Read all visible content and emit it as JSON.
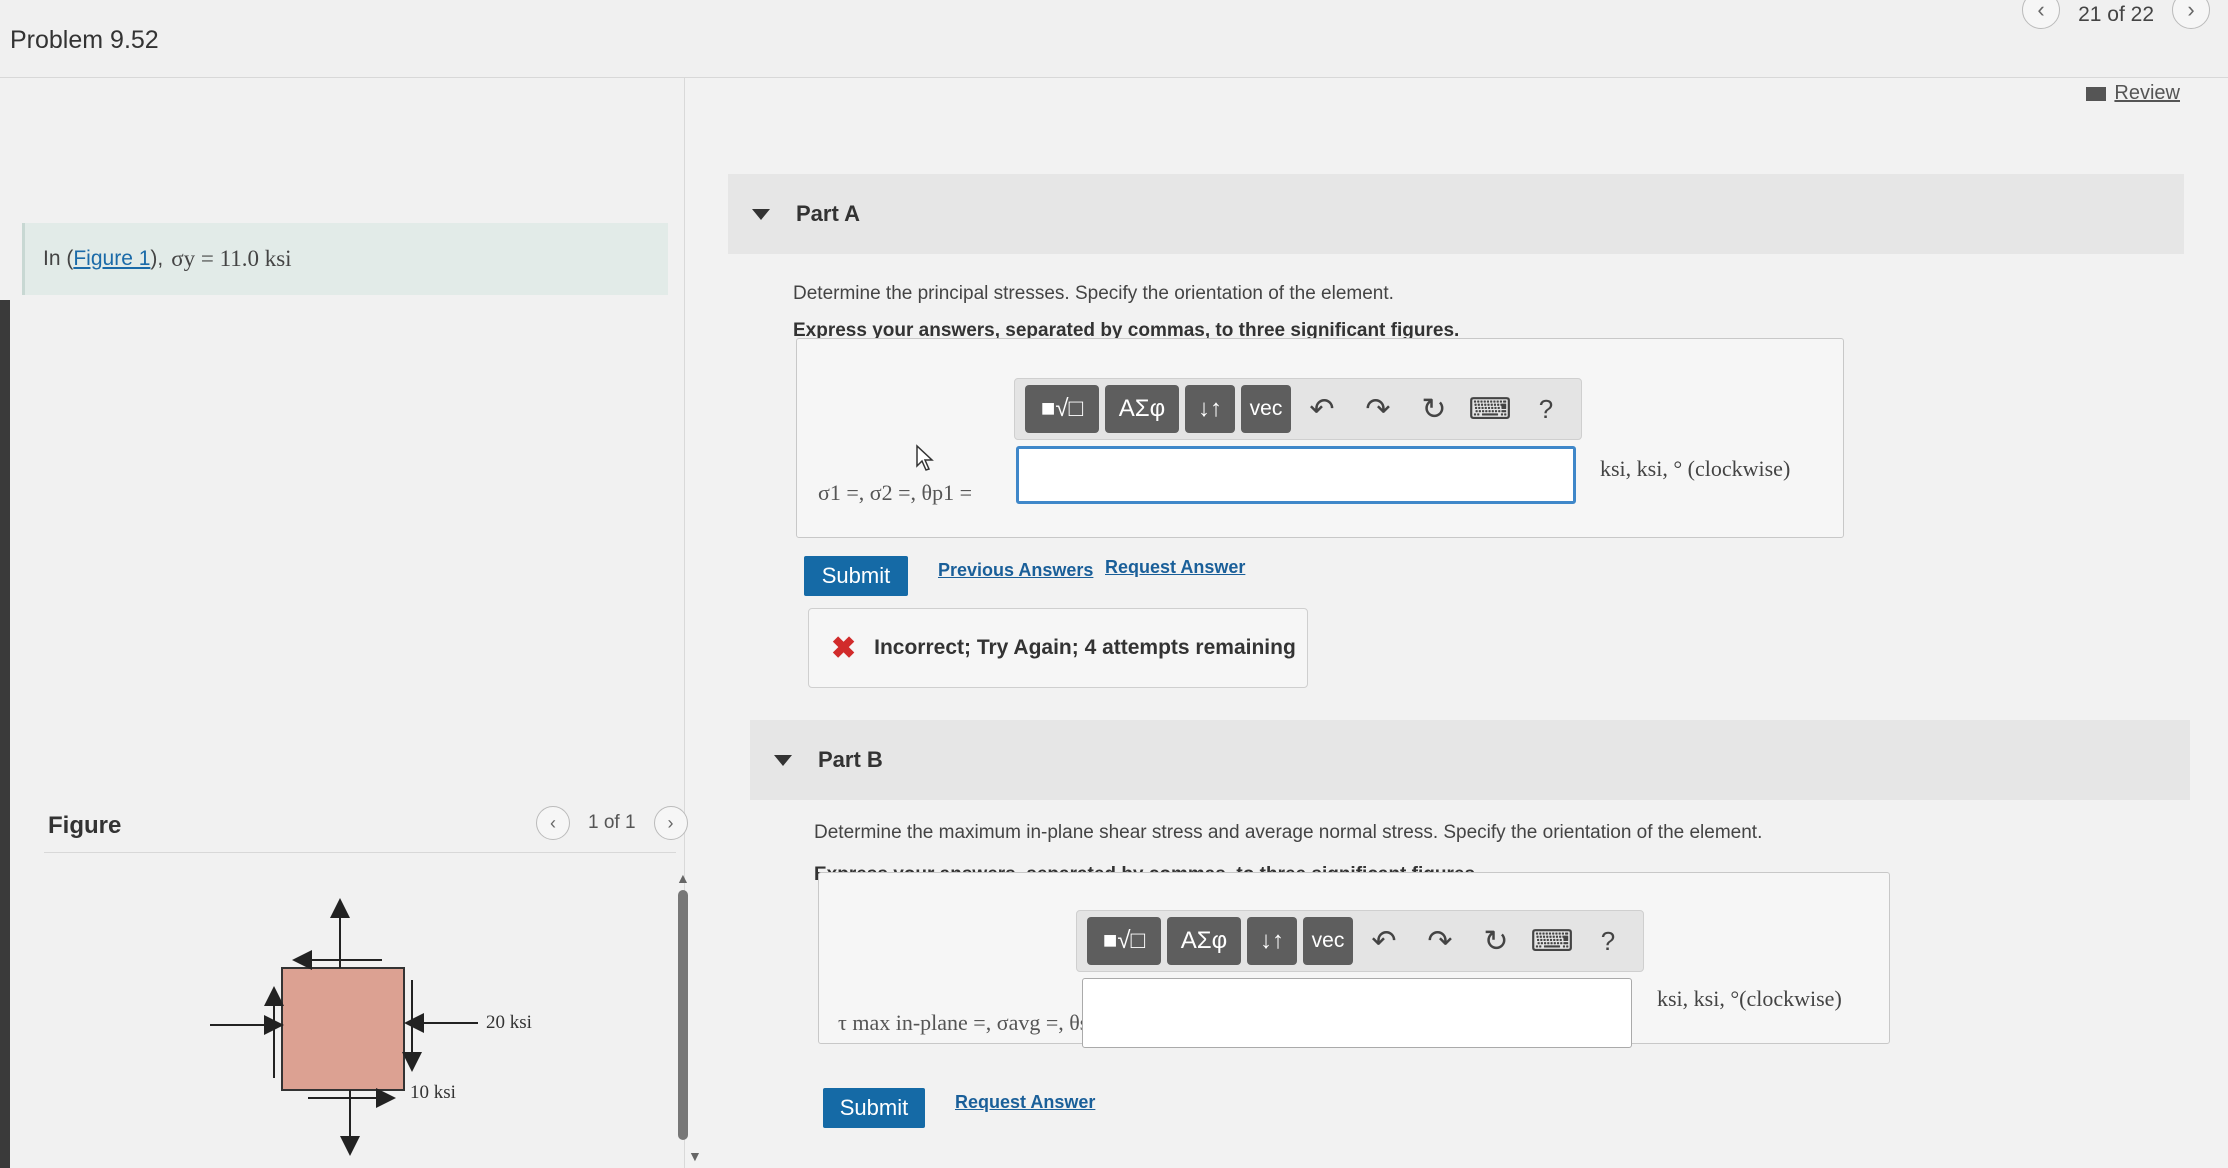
{
  "header": {
    "title": "Problem 9.52",
    "pager_text": "21 of 22",
    "review_label": "Review"
  },
  "problem": {
    "prefix": "In (",
    "figure_link": "Figure 1",
    "suffix": "),",
    "given": "σy = 11.0 ksi"
  },
  "figure_panel": {
    "label": "Figure",
    "pager_text": "1 of 1",
    "diagram": {
      "label_20": "20 ksi",
      "label_10": "10 ksi",
      "element_fill": "#dca192"
    }
  },
  "part_a": {
    "header": "Part A",
    "prompt": "Determine the principal stresses. Specify the orientation of the element.",
    "express": "Express your answers, separated by commas, to three significant figures.",
    "toolbar": {
      "templates": "■√□",
      "greek": "ΑΣφ",
      "arrows": "↓↑",
      "vec": "vec",
      "help": "?"
    },
    "equation_label": "σ1 =, σ2 =, θp1 =",
    "input_value": "",
    "units": "ksi, ksi, ° (clockwise)",
    "submit_label": "Submit",
    "previous_answers": "Previous Answers",
    "request_answer": "Request Answer",
    "feedback": "Incorrect; Try Again; 4 attempts remaining"
  },
  "part_b": {
    "header": "Part B",
    "prompt": "Determine the maximum in-plane shear stress and average normal stress. Specify the orientation of the element.",
    "express": "Express your answers, separated by commas, to three significant figures.",
    "toolbar": {
      "templates": "■√□",
      "greek": "ΑΣφ",
      "arrows": "↓↑",
      "vec": "vec",
      "help": "?"
    },
    "equation_label": "τ max in-plane =, σavg =, θs =",
    "input_value": "",
    "units": "ksi, ksi, °(clockwise)",
    "submit_label": "Submit",
    "request_answer": "Request Answer"
  },
  "colors": {
    "accent": "#156aa6",
    "error": "#d12b2b",
    "toolbar_button": "#5e5e5e"
  }
}
